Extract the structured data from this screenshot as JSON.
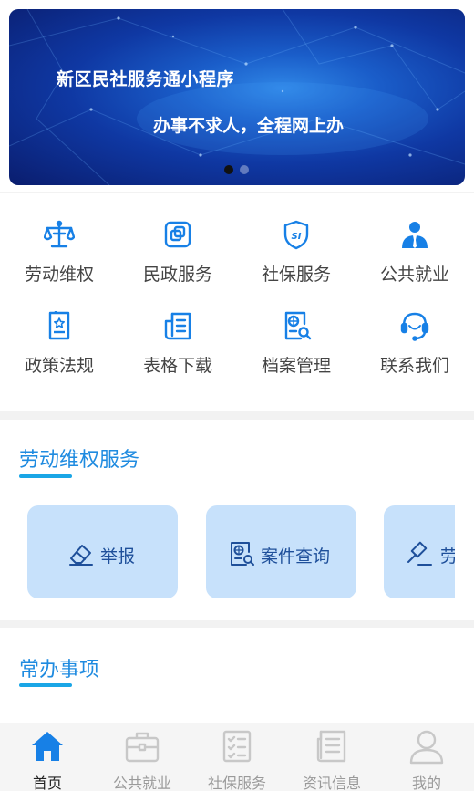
{
  "banner": {
    "title": "新区民社服务通小程序",
    "subtitle": "办事不求人，全程网上办",
    "dots": 2,
    "active_dot": 0
  },
  "grid": {
    "items": [
      {
        "label": "劳动维权",
        "icon": "scales-icon"
      },
      {
        "label": "民政服务",
        "icon": "civil-affairs-icon"
      },
      {
        "label": "社保服务",
        "icon": "social-security-shield-icon"
      },
      {
        "label": "公共就业",
        "icon": "employee-icon"
      },
      {
        "label": "政策法规",
        "icon": "policy-document-icon"
      },
      {
        "label": "表格下载",
        "icon": "form-download-icon"
      },
      {
        "label": "档案管理",
        "icon": "archive-search-icon"
      },
      {
        "label": "联系我们",
        "icon": "headset-icon"
      }
    ]
  },
  "labor_section": {
    "title": "劳动维权服务",
    "cards": [
      {
        "label": "举报",
        "icon": "eraser-report-icon"
      },
      {
        "label": "案件查询",
        "icon": "case-search-icon"
      },
      {
        "label": "劳",
        "icon": "gavel-icon"
      }
    ]
  },
  "common_section": {
    "title": "常办事项"
  },
  "tabbar": {
    "tabs": [
      {
        "label": "首页",
        "icon": "home-icon",
        "active": true
      },
      {
        "label": "公共就业",
        "icon": "briefcase-icon",
        "active": false
      },
      {
        "label": "社保服务",
        "icon": "checklist-icon",
        "active": false
      },
      {
        "label": "资讯信息",
        "icon": "news-icon",
        "active": false
      },
      {
        "label": "我的",
        "icon": "user-icon",
        "active": false
      }
    ]
  },
  "colors": {
    "accent": "#1f8be0",
    "icon_blue": "#1780e6",
    "card_bg": "#c7e1fb",
    "card_text": "#1e4f9a",
    "tab_inactive": "#c8c8c8"
  }
}
